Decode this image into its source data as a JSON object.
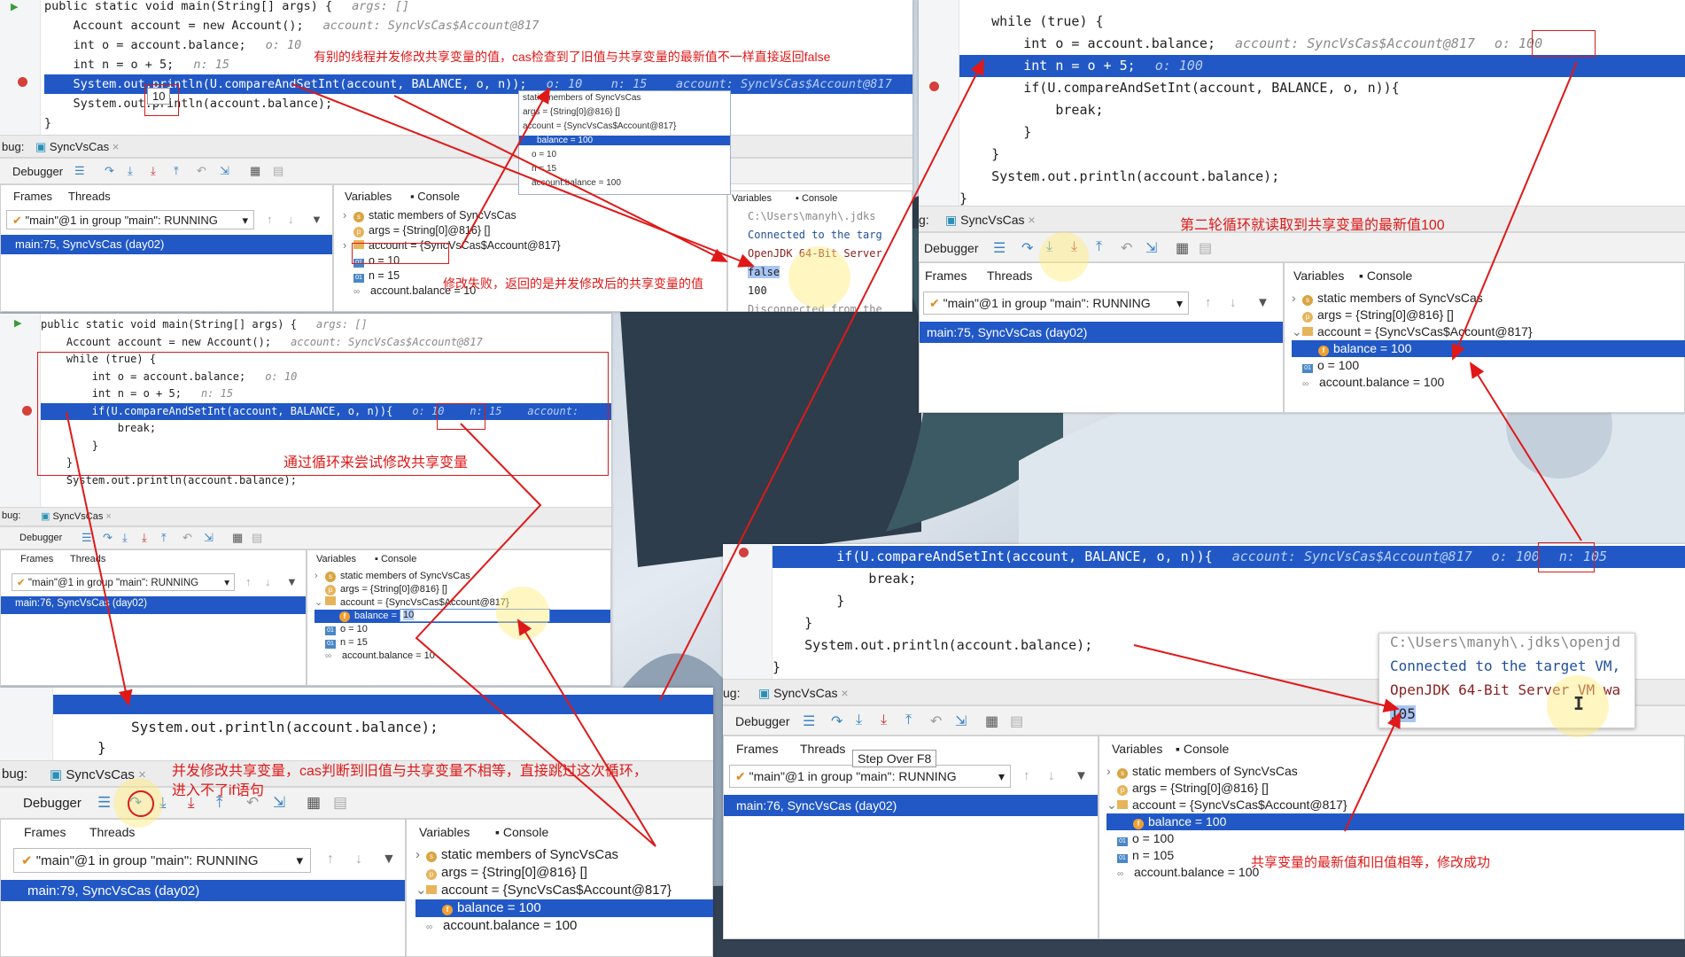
{
  "colors": {
    "accent": "#2158c6",
    "annotation": "#e01818",
    "keyword": "#0033b3"
  },
  "notes": {
    "n1": "有别的线程并发修改共享变量的值，cas检查到了旧值与共享变量的最新值不一样直接返回false",
    "n2": "修改失败，返回的是并发修改后的共享变量的值",
    "n3": "通过循环来尝试修改共享变量",
    "n4": "第二轮循环就读取到共享变量的最新值100",
    "n5a": "并发修改共享变量，cas判断到旧值与共享变量不相等，直接跳过这次循环，",
    "n5b": "进入不了if语句",
    "n6": "共享变量的最新值和旧值相等，修改成功"
  },
  "common": {
    "debug_label": "bug:",
    "tab_title": "SyncVsCas",
    "debugger": "Debugger",
    "frames": "Frames",
    "threads": "Threads",
    "variables": "Variables",
    "console": "Console",
    "thread": "\"main\"@1 in group \"main\": RUNNING",
    "static_members": "static members of SyncVsCas",
    "args": "args = {String[0]@816} []",
    "account": "account = {SyncVsCas$Account@817}"
  },
  "p1": {
    "code": [
      {
        "t": "public static void main(String[] args) {",
        "h": "args: []"
      },
      {
        "t": "    Account account = new Account();",
        "h": "account: SyncVsCas$Account@817"
      },
      {
        "t": "    int o = account.balance;",
        "h": "o: 10"
      },
      {
        "t": "    int n = o + 5;",
        "h": "n: 15"
      },
      {
        "t": "    System.out.println(U.compareAndSetInt(account, BALANCE, o, n));",
        "h": "o: 10    n: 15    account: SyncVsCas$Account@817"
      },
      {
        "t": "    System.out.println(account.balance);",
        "h": ""
      },
      {
        "t": "}",
        "h": ""
      }
    ],
    "tooltip": "10",
    "frame": "main:75, SyncVsCas (day02)",
    "vars": [
      "static members of SyncVsCas",
      "args = {String[0]@816} []",
      "account = {SyncVsCas$Account@817}",
      "o = 10",
      "n = 15",
      "account.balance = 10"
    ],
    "popup": [
      "static members of SyncVsCas",
      "args = {String[0]@816} []",
      "account = {SyncVsCas$Account@817}",
      "balance = 100",
      "o = 10",
      "n = 15",
      "account.balance = 100"
    ],
    "console": [
      "C:\\Users\\manyh\\.jdks",
      "Connected to the targ",
      "OpenJDK 64-Bit Server",
      "false",
      "100",
      "Disconnected from the"
    ]
  },
  "p2": {
    "code": [
      {
        "t": "public static void main(String[] args) {",
        "h": "args: []"
      },
      {
        "t": "    Account account = new Account();",
        "h": "account: SyncVsCas$Account@817"
      },
      {
        "t": "    while (true) {",
        "h": ""
      },
      {
        "t": "        int o = account.balance;",
        "h": "o: 10"
      },
      {
        "t": "        int n = o + 5;",
        "h": "n: 15"
      },
      {
        "t": "        if(U.compareAndSetInt(account, BALANCE, o, n)){",
        "h": "o: 10    n: 15    account: "
      },
      {
        "t": "            break;",
        "h": ""
      },
      {
        "t": "        }",
        "h": ""
      },
      {
        "t": "    }",
        "h": ""
      },
      {
        "t": "    System.out.println(account.balance);",
        "h": ""
      }
    ],
    "frame": "main:76, SyncVsCas (day02)",
    "vars": [
      "static members of SyncVsCas",
      "args = {String[0]@816} []",
      "account = {SyncVsCas$Account@817}",
      "balance = ",
      "o = 10",
      "n = 15",
      "account.balance = 10"
    ],
    "edit_value": "10"
  },
  "p3": {
    "code": "System.out.println(account.balance);",
    "frame": "main:79, SyncVsCas (day02)",
    "vars": [
      "static members of SyncVsCas",
      "args = {String[0]@816} []",
      "account = {SyncVsCas$Account@817}",
      "balance = 100",
      "account.balance = 100"
    ]
  },
  "p4": {
    "code": [
      {
        "t": "    while (true) {",
        "h": ""
      },
      {
        "t": "        int o = account.balance;",
        "h": "account: SyncVsCas$Account@817",
        "h2": "o: 100"
      },
      {
        "t": "        int n = o + 5;",
        "h": "o: 100"
      },
      {
        "t": "        if(U.compareAndSetInt(account, BALANCE, o, n)){",
        "h": ""
      },
      {
        "t": "            break;",
        "h": ""
      },
      {
        "t": "        }",
        "h": ""
      },
      {
        "t": "    }",
        "h": ""
      },
      {
        "t": "    System.out.println(account.balance);",
        "h": ""
      },
      {
        "t": "}",
        "h": ""
      }
    ],
    "frame": "main:75, SyncVsCas (day02)",
    "vars": [
      "static members of SyncVsCas",
      "args = {String[0]@816} []",
      "account = {SyncVsCas$Account@817}",
      "balance = 100",
      "o = 100",
      "account.balance = 100"
    ]
  },
  "p5": {
    "code": [
      {
        "t": "        if(U.compareAndSetInt(account, BALANCE, o, n)){",
        "h": "account: SyncVsCas$Account@817",
        "h2": "o: 100",
        "h3": "n: 105"
      },
      {
        "t": "            break;",
        "h": ""
      },
      {
        "t": "        }",
        "h": ""
      },
      {
        "t": "    }",
        "h": ""
      },
      {
        "t": "    System.out.println(account.balance);",
        "h": ""
      },
      {
        "t": "}",
        "h": ""
      }
    ],
    "tooltip": "Step Over  F8",
    "frame": "main:76, SyncVsCas (day02)",
    "vars": [
      "static members of SyncVsCas",
      "args = {String[0]@816} []",
      "account = {SyncVsCas$Account@817}",
      "balance = 100",
      "o = 100",
      "n = 105",
      "account.balance = 100"
    ],
    "console": [
      "C:\\Users\\manyh\\.jdks\\openjd",
      "Connected to the target VM,",
      "OpenJDK 64-Bit Server VM wa",
      "105"
    ]
  }
}
